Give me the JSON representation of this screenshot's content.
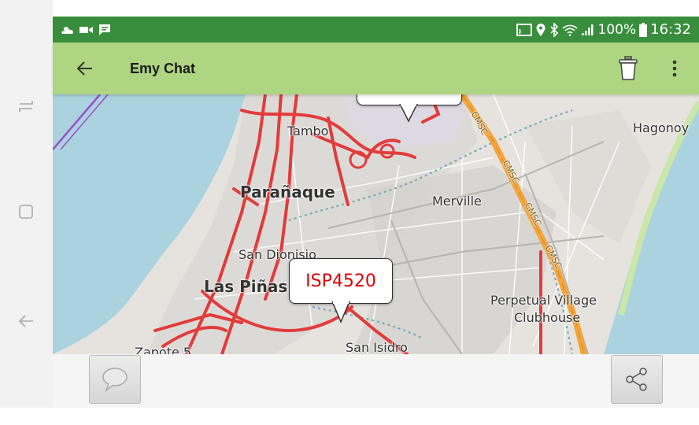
{
  "status_bar": {
    "battery": "100%",
    "time": "16:32",
    "bg_color": "#388e3c"
  },
  "app_bar": {
    "title": "Emy Chat",
    "back_icon": "arrow-left-icon",
    "delete_icon": "trash-icon",
    "menu_icon": "more-vertical-icon",
    "bg_color": "#aed581"
  },
  "map": {
    "labels": {
      "tambo": "Tambo",
      "hagonoy": "Hagonoy",
      "paranaque": "Parañaque",
      "merville": "Merville",
      "san_dionisio": "San Dionisio",
      "las_pinas": "Las Piñas",
      "perpetual_1": "Perpetual Village",
      "perpetual_2": "Clubhouse",
      "zapote": "Zapote 5",
      "san_isidro": "San Isidro",
      "cmsc": "CMSC"
    },
    "marker": {
      "label": "ISP4520",
      "color": "#e00000"
    }
  },
  "bottom_bar": {
    "chat_icon": "speech-bubble-icon",
    "share_icon": "share-icon"
  },
  "system_nav": {
    "recents_icon": "recent-apps-icon",
    "home_icon": "home-icon",
    "back_icon": "back-icon"
  }
}
